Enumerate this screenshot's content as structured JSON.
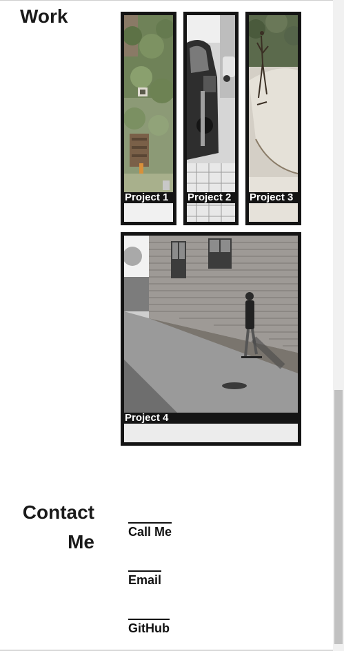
{
  "work": {
    "heading": "Work",
    "projects": [
      {
        "label": "Project 1",
        "image_icon": "garden-photo"
      },
      {
        "label": "Project 2",
        "image_icon": "street-car-photo"
      },
      {
        "label": "Project 3",
        "image_icon": "skatepark-photo"
      },
      {
        "label": "Project 4",
        "image_icon": "skateboarder-alley-photo"
      }
    ]
  },
  "contact": {
    "heading_line1": "Contact",
    "heading_line2": "Me",
    "links": [
      {
        "label": "Call Me"
      },
      {
        "label": "Email"
      },
      {
        "label": "GitHub"
      }
    ]
  },
  "colors": {
    "text": "#1a1a1a",
    "frame": "#141414",
    "label_bg": "#141414",
    "label_text": "#ffffff",
    "background": "#ffffff",
    "scrollbar_track": "#f1f1f1",
    "scrollbar_thumb": "#c1c1c1"
  }
}
